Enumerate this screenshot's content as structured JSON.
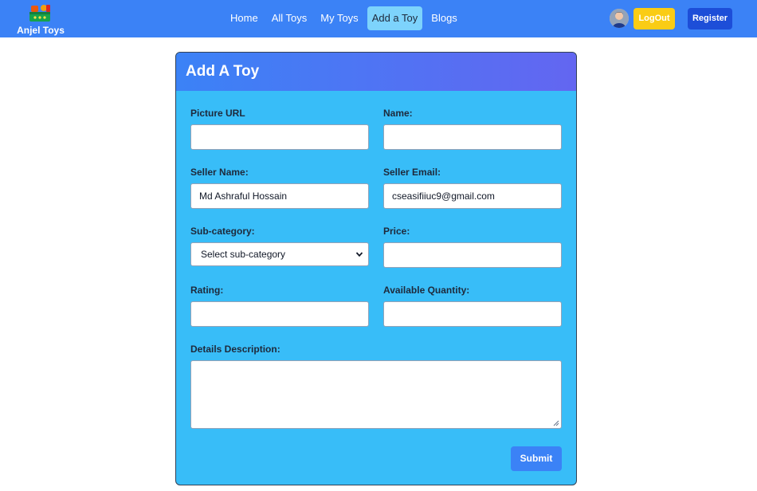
{
  "brand": {
    "name": "Anjel Toys",
    "logo_icon": "toy-basket-icon"
  },
  "nav": {
    "links": [
      {
        "label": "Home",
        "active": false
      },
      {
        "label": "All Toys",
        "active": false
      },
      {
        "label": "My Toys",
        "active": false
      },
      {
        "label": "Add a Toy",
        "active": true
      },
      {
        "label": "Blogs",
        "active": false
      }
    ],
    "logout_label": "LogOut",
    "register_label": "Register"
  },
  "form": {
    "title": "Add A Toy",
    "picture_url": {
      "label": "Picture URL",
      "value": ""
    },
    "name": {
      "label": "Name:",
      "value": ""
    },
    "seller_name": {
      "label": "Seller Name:",
      "value": "Md Ashraful Hossain"
    },
    "seller_email": {
      "label": "Seller Email:",
      "value": "cseasifiiuc9@gmail.com"
    },
    "sub_category": {
      "label": "Sub-category:",
      "selected": "Select sub-category"
    },
    "price": {
      "label": "Price:",
      "value": ""
    },
    "rating": {
      "label": "Rating:",
      "value": ""
    },
    "available_quantity": {
      "label": "Available Quantity:",
      "value": ""
    },
    "details": {
      "label": "Details Description:",
      "value": ""
    },
    "submit_label": "Submit"
  },
  "colors": {
    "navbar": "#3b82f6",
    "card": "#38bdf8",
    "header_gradient_start": "#3b82f6",
    "header_gradient_end": "#6366f1",
    "logout": "#facc15",
    "register": "#1d4ed8",
    "submit": "#3b82f6"
  }
}
